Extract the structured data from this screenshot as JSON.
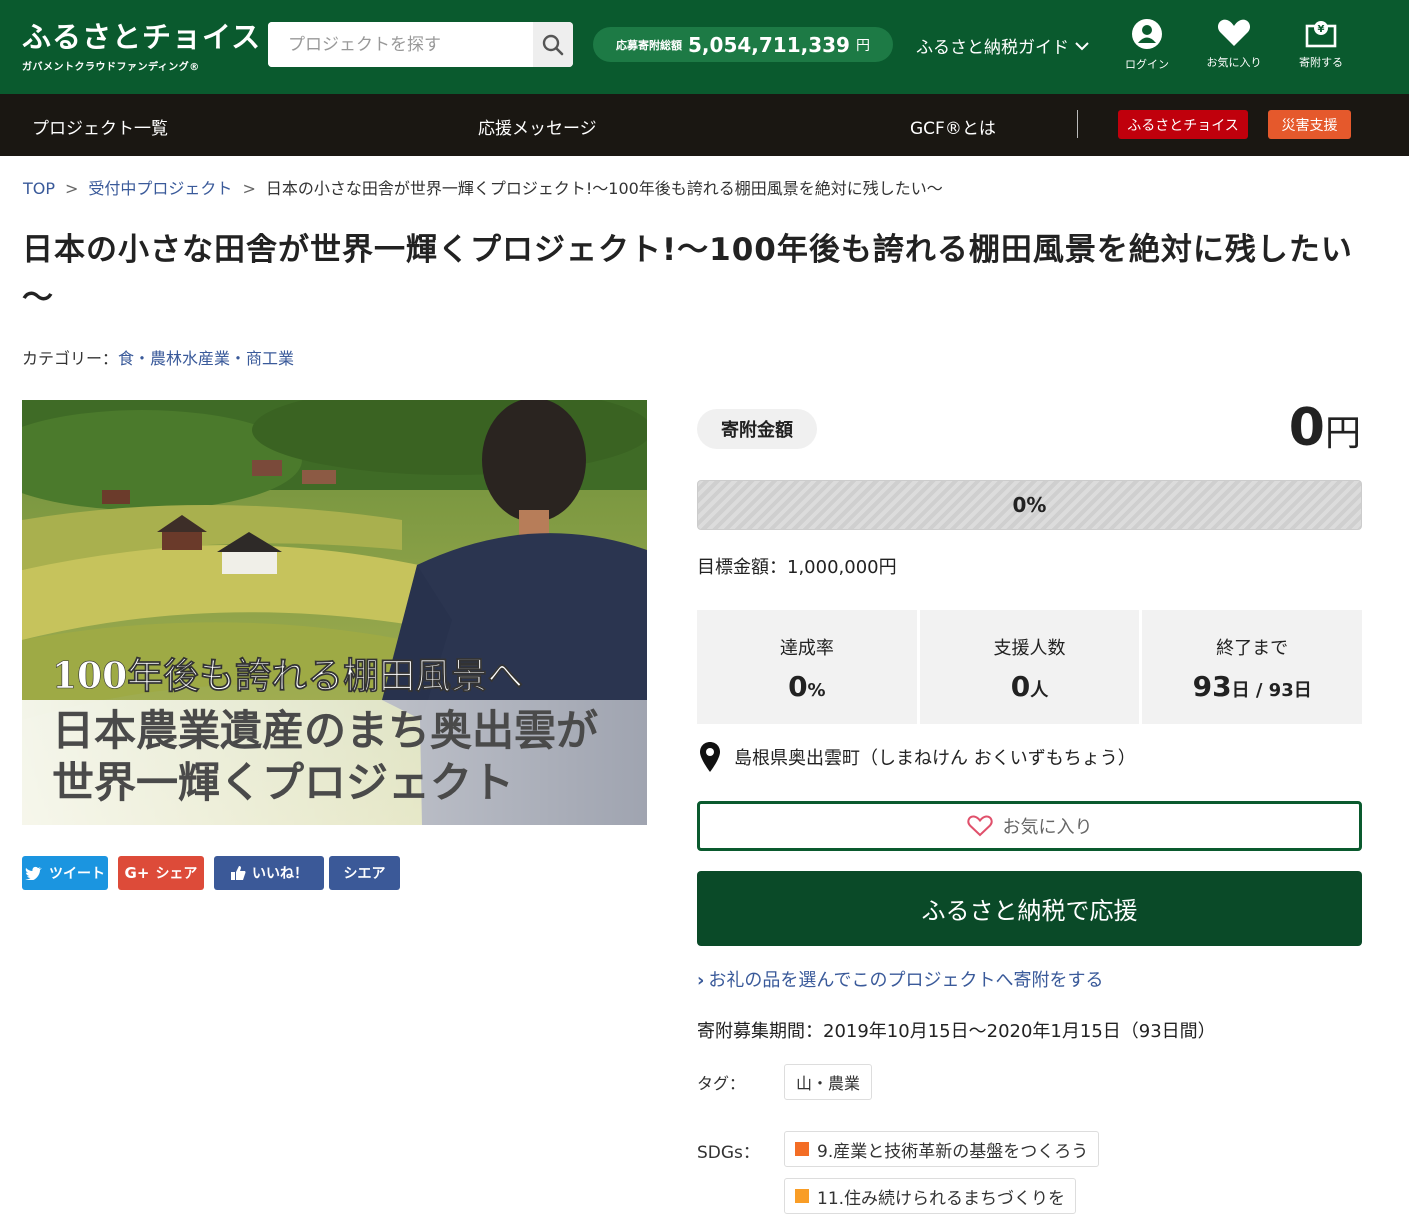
{
  "header": {
    "logo_main": "ふるさとチョイス",
    "logo_sub": "ガバメントクラウドファンディング®",
    "search_placeholder": "プロジェクトを探す",
    "total_label": "応募寄附総額",
    "total_value": "5,054,711,339",
    "total_unit": "円",
    "guide": "ふるさと納税ガイド",
    "icons": [
      {
        "label": "ログイン",
        "icon": "user-icon"
      },
      {
        "label": "お気に入り",
        "icon": "heart-icon"
      },
      {
        "label": "寄附する",
        "icon": "donate-icon"
      }
    ],
    "bg_color": "#0a5a2e"
  },
  "nav": {
    "items": [
      "プロジェクト一覧",
      "応援メッセージ",
      "GCF®とは"
    ],
    "badges": [
      {
        "label": "ふるさとチョイス",
        "color": "#c0000c"
      },
      {
        "label": "災害支援",
        "color": "#e5592c"
      }
    ]
  },
  "breadcrumb": {
    "top": "TOP",
    "list": "受付中プロジェクト",
    "current": "日本の小さな田舎が世界一輝くプロジェクト!～100年後も誇れる棚田風景を絶対に残したい～",
    "sep": ">"
  },
  "title": "日本の小さな田舎が世界一輝くプロジェクト!～100年後も誇れる棚田風景を絶対に残したい～",
  "category": {
    "label": "カテゴリー：",
    "value": "食・農林水産業・商工業"
  },
  "photo": {
    "line1": "100年後も誇れる棚田風景へ",
    "line2": "日本農業遺産のまち奥出雲が",
    "line3": "世界一輝くプロジェクト"
  },
  "share": {
    "tweet": "ツイート",
    "gplus": "シェア",
    "like": "いいね！",
    "fb_share": "シエア"
  },
  "funding": {
    "amount_label": "寄附金額",
    "amount": "0",
    "amount_unit": "円",
    "progress": 0,
    "progress_text": "0%",
    "goal": "目標金額：1,000,000円",
    "stats": {
      "rate_label": "達成率",
      "rate_value": "0",
      "rate_unit": "%",
      "supporters_label": "支援人数",
      "supporters_value": "0",
      "supporters_unit": "人",
      "remaining_label": "終了まで",
      "remaining_value": "93",
      "remaining_unit": "日 / 93日"
    },
    "location": "島根県奥出雲町（しまねけん おくいずもちょう）",
    "favorite": "お気に入り",
    "support_button": "ふるさと納税で応援",
    "gift_link": "お礼の品を選んでこのプロジェクトへ寄附をする",
    "period": "寄附募集期間：2019年10月15日～2020年1月15日（93日間）",
    "tag_label": "タグ：",
    "tag": "山・農業",
    "sdgs_label": "SDGs：",
    "sdgs": [
      {
        "label": "9.産業と技術革新の基盤をつくろう",
        "color": "#f36d25"
      },
      {
        "label": "11.住み続けられるまちづくりを",
        "color": "#f99d26"
      }
    ]
  }
}
